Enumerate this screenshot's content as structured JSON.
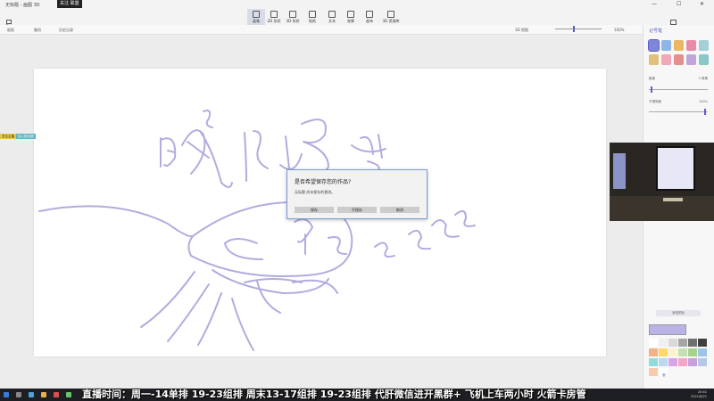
{
  "window": {
    "title": "无标题 - 画图 3D",
    "recording_badge": "关注 联盟",
    "controls": [
      "—",
      "☐",
      "✕"
    ]
  },
  "menu": {
    "label": "菜单"
  },
  "tools": [
    {
      "label": "画笔",
      "active": true
    },
    {
      "label": "2D 形状",
      "active": false
    },
    {
      "label": "3D 形状",
      "active": false
    },
    {
      "label": "贴纸",
      "active": false
    },
    {
      "label": "文本",
      "active": false
    },
    {
      "label": "效果",
      "active": false
    },
    {
      "label": "画布",
      "active": false
    },
    {
      "label": "3D 资源库",
      "active": false
    }
  ],
  "right_tool": {
    "label": "混合现实"
  },
  "subbar": {
    "paste": "粘贴",
    "undo": "撤消",
    "history": "历史记录",
    "view_3d": "3D 视图",
    "zoom": "100%"
  },
  "side_panel": {
    "title": "记号笔",
    "thickness_label": "粗细",
    "thickness_value": "5 像素",
    "opacity_label": "不透明度",
    "opacity_value": "100%",
    "thickness_level": 0.03,
    "opacity_level": 0.97,
    "add_color": "添加颜色",
    "current_color": "#b9b3e6",
    "brushes": [
      {
        "name": "marker-brush",
        "color": "#7d86d8"
      },
      {
        "name": "calligraphy-pen",
        "color": "#8fb5e6"
      },
      {
        "name": "oil-brush",
        "color": "#e9b765"
      },
      {
        "name": "watercolor",
        "color": "#e98aa8"
      },
      {
        "name": "pixel-pen",
        "color": "#a5cfd7"
      },
      {
        "name": "pencil",
        "color": "#e0c07a"
      },
      {
        "name": "eraser",
        "color": "#f0a8b8"
      },
      {
        "name": "crayon",
        "color": "#e58e8e"
      },
      {
        "name": "spray-can",
        "color": "#bfa5d9"
      },
      {
        "name": "fill",
        "color": "#8ac7c9"
      }
    ],
    "palette": [
      "#ffffff",
      "#f0f0f0",
      "#d9d9d9",
      "#a6a6a6",
      "#707070",
      "#404040",
      "#f4b183",
      "#ffd966",
      "#fff2cc",
      "#c5e0b4",
      "#a9d18e",
      "#9dc3e6",
      "#8fdcd9",
      "#bdd7ee",
      "#d5a6e6",
      "#f4a6c6",
      "#c9a0dc",
      "#b4c7e7",
      "#f8cbad",
      "#ffffff"
    ]
  },
  "dialog": {
    "title": "是否希望保存您的作品?",
    "message": "无标题 尚未保存的更改。",
    "save": "保存",
    "dont_save": "不保存",
    "cancel": "取消"
  },
  "overlay": {
    "chip_a": "关注主播",
    "chip_b": "加入粉丝团"
  },
  "taskbar": {
    "time": "20:41",
    "date": "2021/8/21"
  },
  "ticker": "直播时间：周一-14单排 19-23组排 周末13-17组排 19-23组排 代肝微信进开黑群+ 飞机上车两小时 火箭卡房管"
}
